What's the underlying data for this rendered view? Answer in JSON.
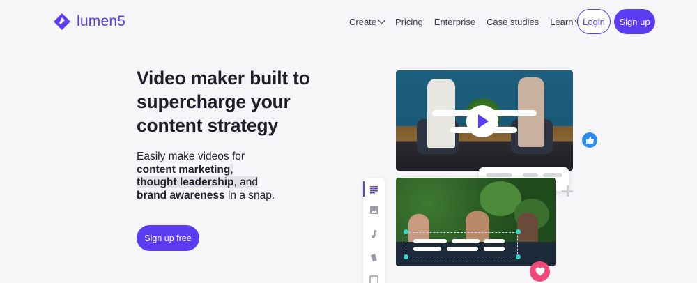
{
  "brand": {
    "name": "lumen5",
    "color": "#5b3cf0"
  },
  "nav": {
    "items": [
      {
        "label": "Create",
        "has_dropdown": true
      },
      {
        "label": "Pricing",
        "has_dropdown": false
      },
      {
        "label": "Enterprise",
        "has_dropdown": false
      },
      {
        "label": "Case studies",
        "has_dropdown": false
      },
      {
        "label": "Learn",
        "has_dropdown": true
      }
    ],
    "login_label": "Login",
    "signup_label": "Sign up"
  },
  "hero": {
    "headline": [
      "Video maker built to",
      "supercharge your",
      "content strategy"
    ],
    "sub": {
      "intro": "Easily make videos for",
      "item1": "content marketing",
      "comma": ",",
      "item2": "thought leadership",
      "and": ", and",
      "item3": "brand awareness",
      "tail": " in a snap."
    },
    "cta_label": "Sign up free"
  },
  "editor": {
    "tools": [
      "text-icon",
      "image-icon",
      "music-icon",
      "style-icon",
      "layout-icon"
    ],
    "badges": [
      "thumbs-up-icon",
      "heart-icon"
    ]
  }
}
